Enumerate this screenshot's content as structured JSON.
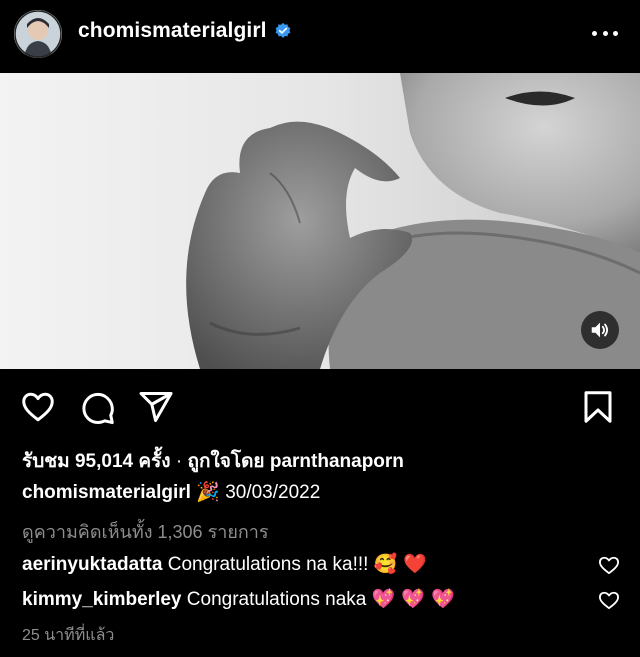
{
  "header": {
    "username": "chomismaterialgirl",
    "verified": true,
    "more_icon": "more-horizontal-icon"
  },
  "media": {
    "type": "video",
    "audio_icon": "speaker-icon"
  },
  "actions": {
    "like_icon": "heart-outline-icon",
    "comment_icon": "comment-bubble-icon",
    "share_icon": "send-paper-plane-icon",
    "save_icon": "bookmark-outline-icon"
  },
  "stats": {
    "views_prefix": "รับชม",
    "views_count": "95,014",
    "views_suffix": "ครั้ง",
    "separator": "·",
    "liked_by_prefix": "ถูกใจโดย",
    "liked_by_user": "parnthanaporn"
  },
  "caption": {
    "username": "chomismaterialgirl",
    "emoji": "🎉",
    "text": "30/03/2022"
  },
  "view_all_comments": "ดูความคิดเห็นทั้ง 1,306 รายการ",
  "comments": [
    {
      "username": "aerinyuktadatta",
      "text": "Congratulations na ka!!!",
      "emojis": "🥰 ❤️"
    },
    {
      "username": "kimmy_kimberley",
      "text": "Congratulations naka",
      "emojis": "💖 💖 💖"
    }
  ],
  "timestamp": "25 นาทีที่แล้ว",
  "colors": {
    "background": "#000000",
    "text": "#ffffff",
    "muted": "#8e8e8e",
    "verified": "#3897f0",
    "heart_red": "#ed4956"
  }
}
